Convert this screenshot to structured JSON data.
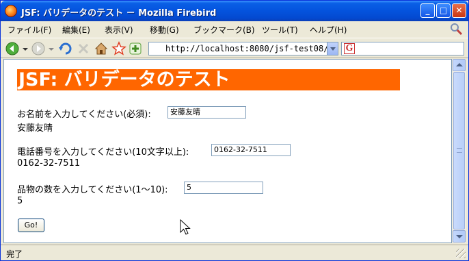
{
  "window": {
    "title": "JSF: バリデータのテスト － Mozilla Firebird"
  },
  "title_buttons": {
    "minimize": "_",
    "maximize": "□",
    "close": "✕"
  },
  "menubar": {
    "items": [
      {
        "label": "ファイル(F)"
      },
      {
        "label": "編集(E)"
      },
      {
        "label": "表示(V)"
      },
      {
        "label": "移動(G)"
      },
      {
        "label": "ブックマーク(B)"
      },
      {
        "label": "ツール(T)"
      },
      {
        "label": "ヘルプ(H)"
      }
    ]
  },
  "toolbar": {
    "url": "http://localhost:8080/jsf-test08/js",
    "search_engine_letter": "G",
    "search_value": ""
  },
  "page": {
    "heading": "JSF: バリデータのテスト",
    "name_label": "お名前を入力してください(必須):",
    "name_value": "安藤友晴",
    "name_echo": "安藤友晴",
    "phone_label": "電話番号を入力してください(10文字以上):",
    "phone_value": "0162-32-7511",
    "phone_echo": "0162-32-7511",
    "qty_label": "品物の数を入力してください(1〜10):",
    "qty_value": "5",
    "qty_echo": "5",
    "submit_label": "Go!"
  },
  "statusbar": {
    "text": "完了"
  },
  "colors": {
    "heading_bg": "#ff6600",
    "titlebar": "#0453dd"
  }
}
